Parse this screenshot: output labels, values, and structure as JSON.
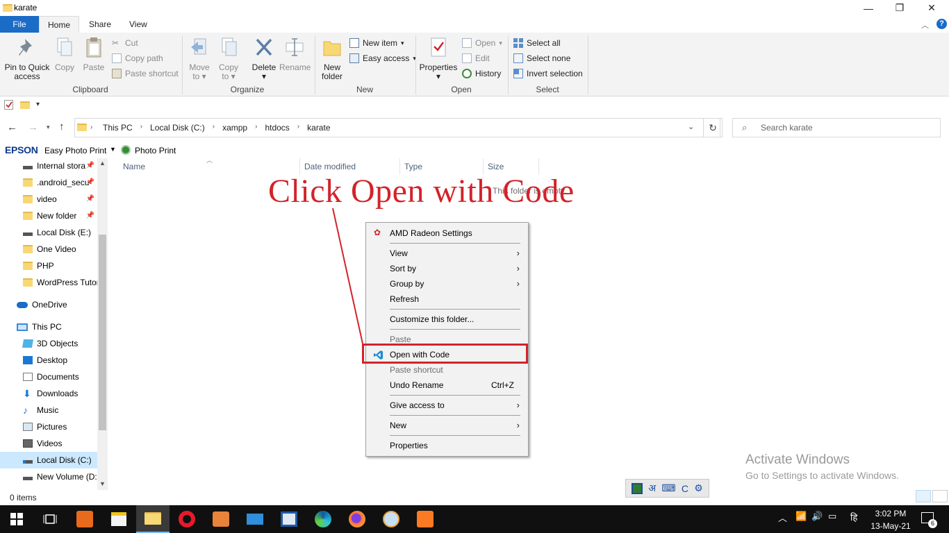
{
  "window": {
    "title": "karate",
    "minimize": "—",
    "maximize": "❐",
    "close": "✕"
  },
  "tabs": {
    "file": "File",
    "home": "Home",
    "share": "Share",
    "view": "View"
  },
  "ribbon": {
    "clipboard": {
      "label": "Clipboard",
      "pin_line1": "Pin to Quick",
      "pin_line2": "access",
      "copy": "Copy",
      "paste": "Paste",
      "cut": "Cut",
      "copy_path": "Copy path",
      "paste_shortcut": "Paste shortcut"
    },
    "organize": {
      "label": "Organize",
      "move_line1": "Move",
      "move_line2": "to",
      "copy_line1": "Copy",
      "copy_line2": "to",
      "delete": "Delete",
      "rename": "Rename"
    },
    "new": {
      "label": "New",
      "new_folder_line1": "New",
      "new_folder_line2": "folder",
      "new_item": "New item",
      "easy_access": "Easy access"
    },
    "open": {
      "label": "Open",
      "properties": "Properties",
      "open": "Open",
      "edit": "Edit",
      "history": "History"
    },
    "select": {
      "label": "Select",
      "select_all": "Select all",
      "select_none": "Select none",
      "invert_selection": "Invert selection"
    }
  },
  "address": {
    "crumbs": [
      "This PC",
      "Local Disk (C:)",
      "xampp",
      "htdocs",
      "karate"
    ],
    "search_placeholder": "Search karate"
  },
  "epson": {
    "brand": "EPSON",
    "easy_photo_print": "Easy Photo Print",
    "photo_print": "Photo Print"
  },
  "nav": {
    "quick": [
      "Internal stora",
      ".android_secu",
      "video",
      "New folder",
      "Local Disk (E:)",
      "One Video",
      "PHP",
      "WordPress Tutor"
    ],
    "onedrive": "OneDrive",
    "this_pc": "This PC",
    "pc_items": [
      "3D Objects",
      "Desktop",
      "Documents",
      "Downloads",
      "Music",
      "Pictures",
      "Videos",
      "Local Disk (C:)",
      "New Volume (D:"
    ]
  },
  "columns": {
    "name": "Name",
    "date_modified": "Date modified",
    "type": "Type",
    "size": "Size"
  },
  "empty_message": "This folder is empty.",
  "annotation": "Click Open with Code",
  "context_menu": {
    "amd": "AMD Radeon Settings",
    "view": "View",
    "sort_by": "Sort by",
    "group_by": "Group by",
    "refresh": "Refresh",
    "customize": "Customize this folder...",
    "paste": "Paste",
    "open_with_code": "Open with Code",
    "paste_shortcut": "Paste shortcut",
    "undo_rename": "Undo Rename",
    "undo_accel": "Ctrl+Z",
    "give_access": "Give access to",
    "new": "New",
    "properties": "Properties"
  },
  "watermark": {
    "line1": "Activate Windows",
    "line2": "Go to Settings to activate Windows."
  },
  "status": {
    "items": "0 items"
  },
  "ime": {
    "hindi": "अ",
    "c": "C"
  },
  "tray": {
    "lang": "हि",
    "time": "3:02 PM",
    "date": "13-May-21",
    "notifications": "6"
  },
  "colors": {
    "accent": "#1a6cc7",
    "annotation": "#d2232a",
    "taskbar": "#101010"
  }
}
